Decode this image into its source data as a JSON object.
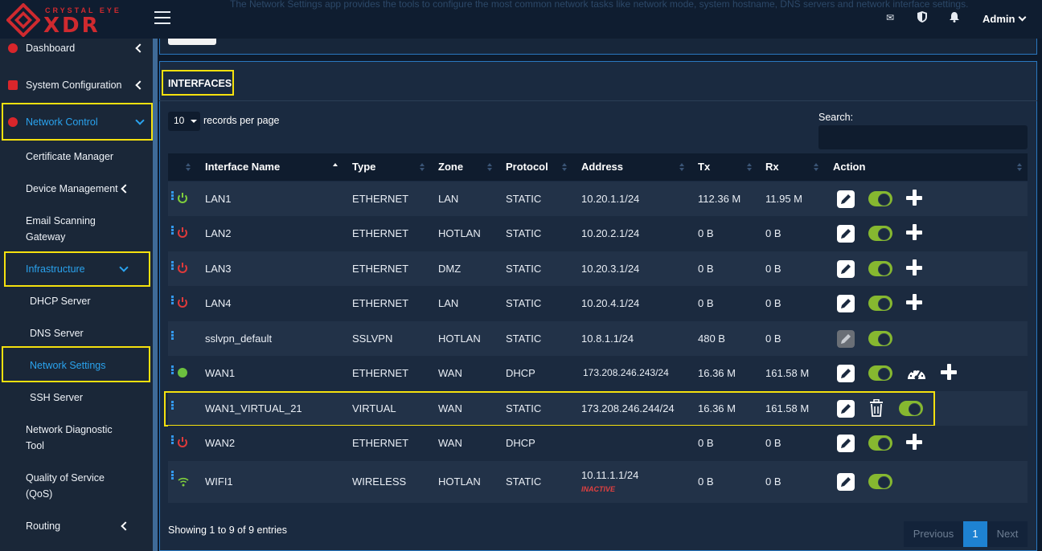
{
  "header": {
    "brand_top": "CRYSTAL EYE",
    "brand_main": "XDR",
    "intro_text": "The Network Settings app provides the tools to configure the most common network tasks like network mode, system hostname, DNS servers and network interface settings.",
    "user_label": "Admin",
    "icons": [
      "envelope-icon",
      "shield-icon",
      "bell-icon"
    ]
  },
  "sidebar": {
    "items": [
      {
        "label": "Dashboard"
      },
      {
        "label": "System Configuration"
      },
      {
        "label": "Network Control"
      },
      {
        "label": "Certificate Manager"
      },
      {
        "label": "Device Management"
      },
      {
        "label": "Email Scanning"
      },
      {
        "label": "Gateway"
      },
      {
        "label": "Infrastructure"
      },
      {
        "label": "DHCP Server"
      },
      {
        "label": "DNS Server"
      },
      {
        "label": "Network Settings"
      },
      {
        "label": "SSH Server"
      },
      {
        "label": "Network Diagnostic"
      },
      {
        "label": "Tool"
      },
      {
        "label": "Quality of Service"
      },
      {
        "label": "(QoS)"
      },
      {
        "label": "Routing"
      }
    ],
    "active_color": "#2aa3ee"
  },
  "panel": {
    "title": "INTERFACES",
    "page_length": "10",
    "records_per_page": "records per page",
    "search_label": "Search:",
    "search_value": ""
  },
  "table": {
    "columns": [
      "Interface Name",
      "Type",
      "Zone",
      "Protocol",
      "Address",
      "Tx",
      "Rx",
      "Action"
    ],
    "rows": [
      {
        "name": "LAN1",
        "type": "ETHERNET",
        "zone": "LAN",
        "protocol": "STATIC",
        "address": "10.20.1.1/24",
        "tx": "112.36 M",
        "rx": "11.95 M",
        "status": "up"
      },
      {
        "name": "LAN2",
        "type": "ETHERNET",
        "zone": "HOTLAN",
        "protocol": "STATIC",
        "address": "10.20.2.1/24",
        "tx": "0 B",
        "rx": "0 B",
        "status": "down"
      },
      {
        "name": "LAN3",
        "type": "ETHERNET",
        "zone": "DMZ",
        "protocol": "STATIC",
        "address": "10.20.3.1/24",
        "tx": "0 B",
        "rx": "0 B",
        "status": "down"
      },
      {
        "name": "LAN4",
        "type": "ETHERNET",
        "zone": "LAN",
        "protocol": "STATIC",
        "address": "10.20.4.1/24",
        "tx": "0 B",
        "rx": "0 B",
        "status": "down"
      },
      {
        "name": "sslvpn_default",
        "type": "SSLVPN",
        "zone": "HOTLAN",
        "protocol": "STATIC",
        "address": "10.8.1.1/24",
        "tx": "480 B",
        "rx": "0 B",
        "status": "none"
      },
      {
        "name": "WAN1",
        "type": "ETHERNET",
        "zone": "WAN",
        "protocol": "DHCP",
        "address": "173.208.246.243/24",
        "tx": "16.36 M",
        "rx": "161.58 M",
        "status": "globe"
      },
      {
        "name": "WAN1_VIRTUAL_21",
        "type": "VIRTUAL",
        "zone": "WAN",
        "protocol": "STATIC",
        "address": "173.208.246.244/24",
        "tx": "16.36 M",
        "rx": "161.58 M",
        "status": "none"
      },
      {
        "name": "WAN2",
        "type": "ETHERNET",
        "zone": "WAN",
        "protocol": "DHCP",
        "address": "",
        "tx": "0 B",
        "rx": "0 B",
        "status": "down"
      },
      {
        "name": "WIFI1",
        "type": "WIRELESS",
        "zone": "HOTLAN",
        "protocol": "STATIC",
        "address": "10.11.1.1/24",
        "address_note": "INACTIVE",
        "tx": "0 B",
        "rx": "0 B",
        "status": "wifi"
      }
    ]
  },
  "footer": {
    "info": "Showing 1 to 9 of 9 entries",
    "prev_label": "Previous",
    "current_page": "1",
    "next_label": "Next"
  },
  "colors": {
    "highlight": "#f5e10e",
    "toggle_on": "#86b830",
    "brand_red": "#cf2a2f",
    "accent_blue": "#2aa3ee"
  }
}
